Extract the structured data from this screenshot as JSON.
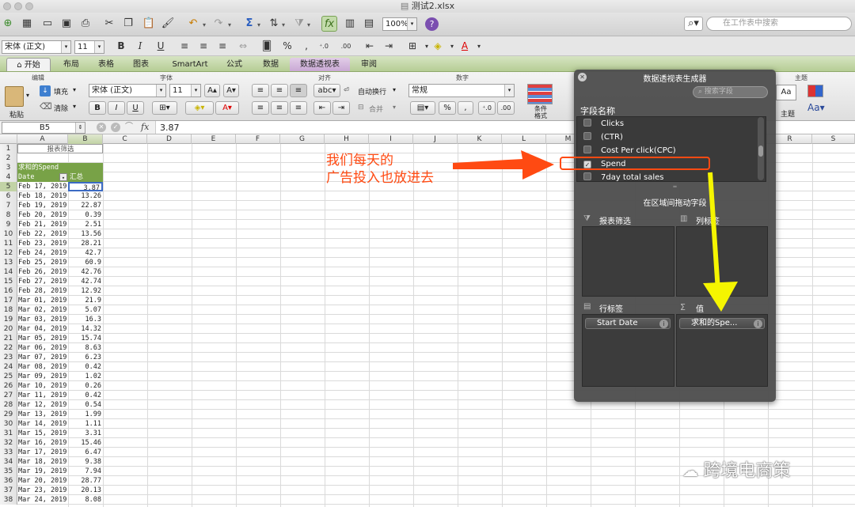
{
  "window": {
    "title": "测试2.xlsx"
  },
  "toolbar": {
    "zoom": "100%",
    "search_placeholder": "在工作表中搜索"
  },
  "format_bar": {
    "font": "宋体 (正文)",
    "size": "11"
  },
  "tabs": [
    "开始",
    "布局",
    "表格",
    "图表",
    "SmartArt",
    "公式",
    "数据",
    "数据透视表",
    "审阅"
  ],
  "ribbon": {
    "groups": {
      "edit": "编辑",
      "font": "字体",
      "align": "对齐",
      "number": "数字",
      "theme": "主题"
    },
    "fill": "填充",
    "clear": "清除",
    "paste": "粘贴",
    "font": "宋体 (正文)",
    "size": "11",
    "wrap": "自动换行",
    "merge": "合并",
    "number_format": "常规",
    "conditional": "条件格式",
    "theme_label": "主题"
  },
  "formula_bar": {
    "cell": "B5",
    "fx": "fx",
    "value": "3.87"
  },
  "columns": [
    "A",
    "B",
    "C",
    "D",
    "E",
    "F",
    "G",
    "H",
    "I",
    "J",
    "K",
    "L",
    "M",
    "N",
    "O",
    "P",
    "Q",
    "R",
    "S"
  ],
  "sheet": {
    "filter_label": "报表筛选",
    "sum_label": "求和的Spend",
    "header_date": "Date",
    "header_total": "汇总",
    "rows": [
      [
        "Feb 17, 2019",
        "3.87"
      ],
      [
        "Feb 18, 2019",
        "13.26"
      ],
      [
        "Feb 19, 2019",
        "22.87"
      ],
      [
        "Feb 20, 2019",
        "0.39"
      ],
      [
        "Feb 21, 2019",
        "2.51"
      ],
      [
        "Feb 22, 2019",
        "13.56"
      ],
      [
        "Feb 23, 2019",
        "28.21"
      ],
      [
        "Feb 24, 2019",
        "42.7"
      ],
      [
        "Feb 25, 2019",
        "60.9"
      ],
      [
        "Feb 26, 2019",
        "42.76"
      ],
      [
        "Feb 27, 2019",
        "42.74"
      ],
      [
        "Feb 28, 2019",
        "12.92"
      ],
      [
        "Mar 01, 2019",
        "21.9"
      ],
      [
        "Mar 02, 2019",
        "5.07"
      ],
      [
        "Mar 03, 2019",
        "16.3"
      ],
      [
        "Mar 04, 2019",
        "14.32"
      ],
      [
        "Mar 05, 2019",
        "15.74"
      ],
      [
        "Mar 06, 2019",
        "8.63"
      ],
      [
        "Mar 07, 2019",
        "6.23"
      ],
      [
        "Mar 08, 2019",
        "0.42"
      ],
      [
        "Mar 09, 2019",
        "1.02"
      ],
      [
        "Mar 10, 2019",
        "0.26"
      ],
      [
        "Mar 11, 2019",
        "0.42"
      ],
      [
        "Mar 12, 2019",
        "0.54"
      ],
      [
        "Mar 13, 2019",
        "1.99"
      ],
      [
        "Mar 14, 2019",
        "1.11"
      ],
      [
        "Mar 15, 2019",
        "3.31"
      ],
      [
        "Mar 16, 2019",
        "15.46"
      ],
      [
        "Mar 17, 2019",
        "6.47"
      ],
      [
        "Mar 18, 2019",
        "9.38"
      ],
      [
        "Mar 19, 2019",
        "7.94"
      ],
      [
        "Mar 20, 2019",
        "28.77"
      ],
      [
        "Mar 23, 2019",
        "20.13"
      ],
      [
        "Mar 24, 2019",
        "8.08"
      ]
    ]
  },
  "pivot": {
    "title": "数据透视表生成器",
    "search_placeholder": "搜索字段",
    "field_list_label": "字段名称",
    "fields": [
      {
        "name": "Clicks",
        "checked": false
      },
      {
        "name": "(CTR)",
        "checked": false
      },
      {
        "name": "Cost Per click(CPC)",
        "checked": false
      },
      {
        "name": "Spend",
        "checked": true
      },
      {
        "name": "7day total sales",
        "checked": false
      }
    ],
    "drag_hint": "在区域间拖动字段",
    "zones": {
      "filter": "报表筛选",
      "columns": "列标签",
      "rows": "行标签",
      "values": "值"
    },
    "row_chip": "Start Date",
    "value_chip": "求和的Spe..."
  },
  "annotation": {
    "line1": "我们每天的",
    "line2": "广告投入也放进去",
    "color": "#ff4a12"
  },
  "watermark": "跨境电商策",
  "colors": {
    "accent_green": "#78a247",
    "arrow_yellow": "#f5f500",
    "callout_red": "#ff4a12"
  }
}
